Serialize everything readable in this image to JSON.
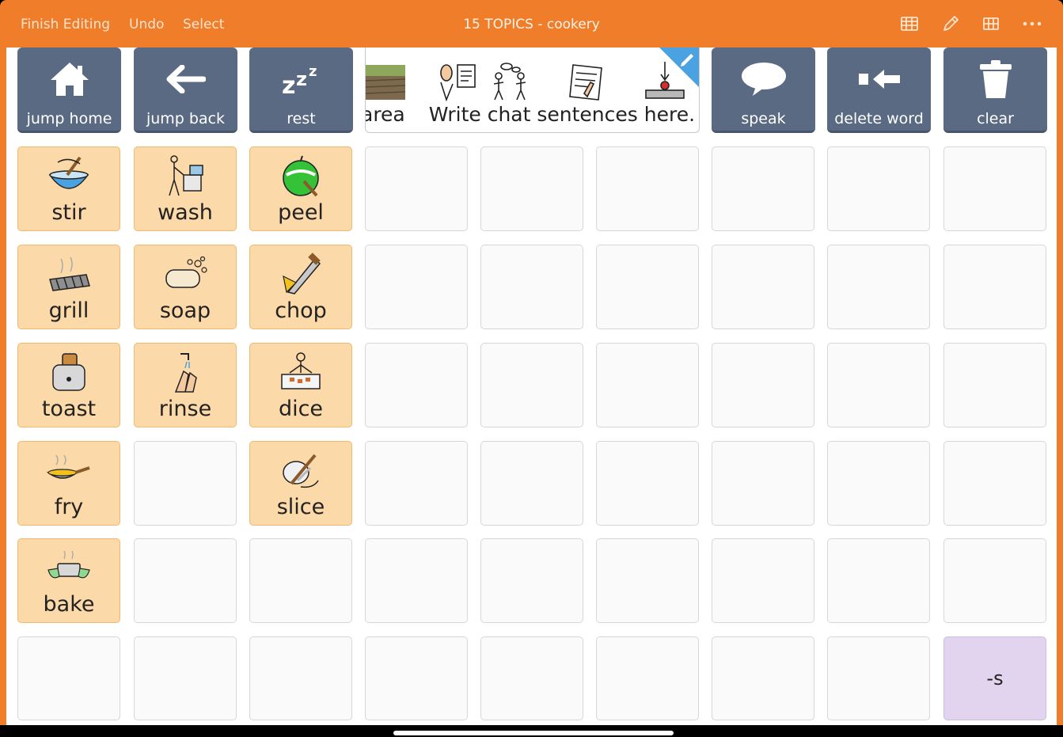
{
  "topbar": {
    "finish_editing": "Finish Editing",
    "undo": "Undo",
    "select": "Select",
    "title": "15 TOPICS - cookery",
    "icons": [
      "grid-table-icon",
      "pencil-icon",
      "grid-icon",
      "more-icon"
    ]
  },
  "nav": {
    "jump_home": "jump home",
    "jump_back": "jump back",
    "rest": "rest",
    "speak": "speak",
    "delete_word": "delete word",
    "clear": "clear"
  },
  "chat": {
    "partial": "area",
    "sentence": "Write chat sentences here."
  },
  "words": {
    "stir": "stir",
    "wash": "wash",
    "peel": "peel",
    "grill": "grill",
    "soap": "soap",
    "chop": "chop",
    "toast": "toast",
    "rinse": "rinse",
    "dice": "dice",
    "fry": "fry",
    "slice": "slice",
    "bake": "bake"
  },
  "suffix": "-s",
  "colors": {
    "accent": "#f07d2a",
    "nav_button": "#5b6a83",
    "word_cell": "#fcd9a8",
    "suffix_cell": "#e2d4ee"
  }
}
